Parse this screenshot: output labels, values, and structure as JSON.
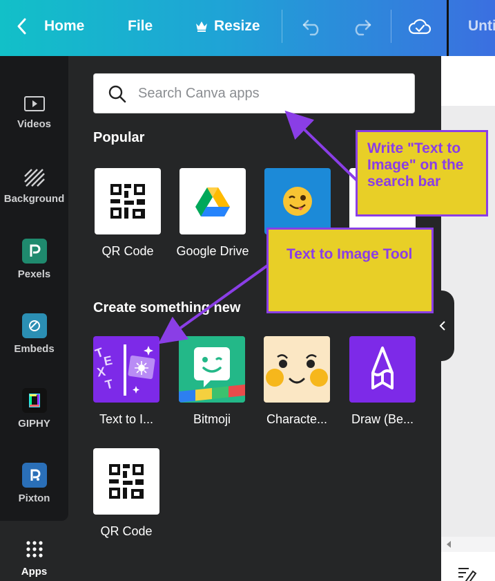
{
  "topbar": {
    "home_label": "Home",
    "file_label": "File",
    "resize_label": "Resize",
    "title": "Unti"
  },
  "rail": {
    "items": [
      {
        "label": "Videos"
      },
      {
        "label": "Background"
      },
      {
        "label": "Pexels"
      },
      {
        "label": "Embeds"
      },
      {
        "label": "GIPHY"
      },
      {
        "label": "Pixton"
      },
      {
        "label": "Apps"
      }
    ]
  },
  "search": {
    "placeholder": "Search Canva apps"
  },
  "popular": {
    "title": "Popular",
    "apps": [
      {
        "label": "QR Code"
      },
      {
        "label": "Google Drive"
      },
      {
        "label": ""
      }
    ]
  },
  "create": {
    "title": "Create something new",
    "apps": [
      {
        "label": "Text to I..."
      },
      {
        "label": "Bitmoji"
      },
      {
        "label": "Characte..."
      },
      {
        "label": "Draw (Be..."
      },
      {
        "label": "QR Code"
      }
    ]
  },
  "annotations": {
    "search_note": "Write \"Text to Image\" on the search bar",
    "tool_note": "Text to Image Tool"
  },
  "colors": {
    "callout_fill": "#e8cf27",
    "callout_border": "#8a3ee6",
    "accent_purple": "#7d2ae8"
  }
}
